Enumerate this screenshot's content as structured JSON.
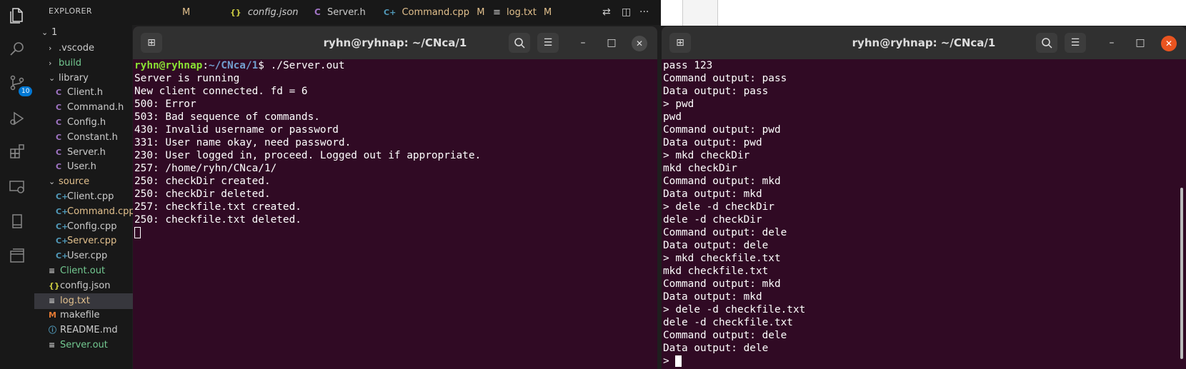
{
  "activity_bar": {
    "icons": [
      "files-icon",
      "search-icon",
      "source-control-icon",
      "run-debug-icon",
      "extensions-icon",
      "remote-explorer-icon",
      "book-icon",
      "panels-icon"
    ],
    "scm_badge": "10"
  },
  "explorer": {
    "title": "EXPLORER",
    "more": "···",
    "root": "1",
    "items": [
      {
        "label": ".vscode",
        "type": "folder",
        "color": "#cccccc"
      },
      {
        "label": "build",
        "type": "folder",
        "color": "#73c991"
      },
      {
        "label": "library",
        "type": "folder-open",
        "color": "#cccccc"
      },
      {
        "label": "Client.h",
        "icon": "C",
        "color": "#cccccc"
      },
      {
        "label": "Command.h",
        "icon": "C",
        "color": "#cccccc"
      },
      {
        "label": "Config.h",
        "icon": "C",
        "color": "#cccccc"
      },
      {
        "label": "Constant.h",
        "icon": "C",
        "color": "#cccccc"
      },
      {
        "label": "Server.h",
        "icon": "C",
        "color": "#cccccc"
      },
      {
        "label": "User.h",
        "icon": "C",
        "color": "#cccccc"
      },
      {
        "label": "source",
        "type": "folder-open",
        "color": "#e2c08d"
      },
      {
        "label": "Client.cpp",
        "icon": "C+",
        "color": "#cccccc"
      },
      {
        "label": "Command.cpp",
        "icon": "C+",
        "color": "#e2c08d"
      },
      {
        "label": "Config.cpp",
        "icon": "C+",
        "color": "#cccccc"
      },
      {
        "label": "Server.cpp",
        "icon": "C+",
        "color": "#e2c08d"
      },
      {
        "label": "User.cpp",
        "icon": "C+",
        "color": "#cccccc"
      },
      {
        "label": "Client.out",
        "icon": "≡",
        "color": "#73c991"
      },
      {
        "label": "config.json",
        "icon": "{}",
        "color": "#cccccc"
      },
      {
        "label": "log.txt",
        "icon": "≡",
        "color": "#e2c08d",
        "selected": true
      },
      {
        "label": "makefile",
        "icon": "M",
        "color": "#cccccc"
      },
      {
        "label": "README.md",
        "icon": "ⓘ",
        "color": "#cccccc"
      },
      {
        "label": "Server.out",
        "icon": "≡",
        "color": "#73c991"
      }
    ]
  },
  "tabs": [
    {
      "label": "M",
      "icon": "",
      "italic": false
    },
    {
      "label": "config.json",
      "icon": "{}",
      "italic": true
    },
    {
      "label": "Server.h",
      "icon": "C",
      "italic": false
    },
    {
      "label": "Command.cpp",
      "icon": "C+",
      "italic": false,
      "modified": "M",
      "color": "#e2c08d"
    },
    {
      "label": "log.txt",
      "icon": "≡",
      "italic": false,
      "modified": "M",
      "color": "#e2c08d"
    }
  ],
  "terminal_left": {
    "title": "ryhn@ryhnap: ~/CNca/1",
    "prompt_user": "ryhn@ryhnap",
    "prompt_sep": ":",
    "prompt_path": "~/CNca/1",
    "prompt_cmd": "$ ./Server.out",
    "lines": [
      "Server is running",
      "New client connected. fd = 6",
      "500: Error",
      "503: Bad sequence of commands.",
      "430: Invalid username or password",
      "331: User name okay, need password.",
      "230: User logged in, proceed. Logged out if appropriate.",
      "257: /home/ryhn/CNca/1/",
      "250: checkDir created.",
      "250: checkDir deleted.",
      "257: checkfile.txt created.",
      "250: checkfile.txt deleted."
    ]
  },
  "terminal_right": {
    "title": "ryhn@ryhnap: ~/CNca/1",
    "lines": [
      "pass 123",
      "Command output: pass",
      "Data output: pass",
      "> pwd",
      "pwd",
      "Command output: pwd",
      "Data output: pwd",
      "> mkd checkDir",
      "mkd checkDir",
      "Command output: mkd",
      "Data output: mkd",
      "> dele -d checkDir",
      "dele -d checkDir",
      "Command output: dele",
      "Data output: dele",
      "> mkd checkfile.txt",
      "mkd checkfile.txt",
      "Command output: mkd",
      "Data output: mkd",
      "> dele -d checkfile.txt",
      "dele -d checkfile.txt",
      "Command output: dele",
      "Data output: dele"
    ],
    "prompt": "> "
  },
  "colors": {
    "terminal_bg": "#300a24",
    "titlebar_bg": "#303030",
    "close_active": "#e95420",
    "accent": "#0078d4"
  }
}
